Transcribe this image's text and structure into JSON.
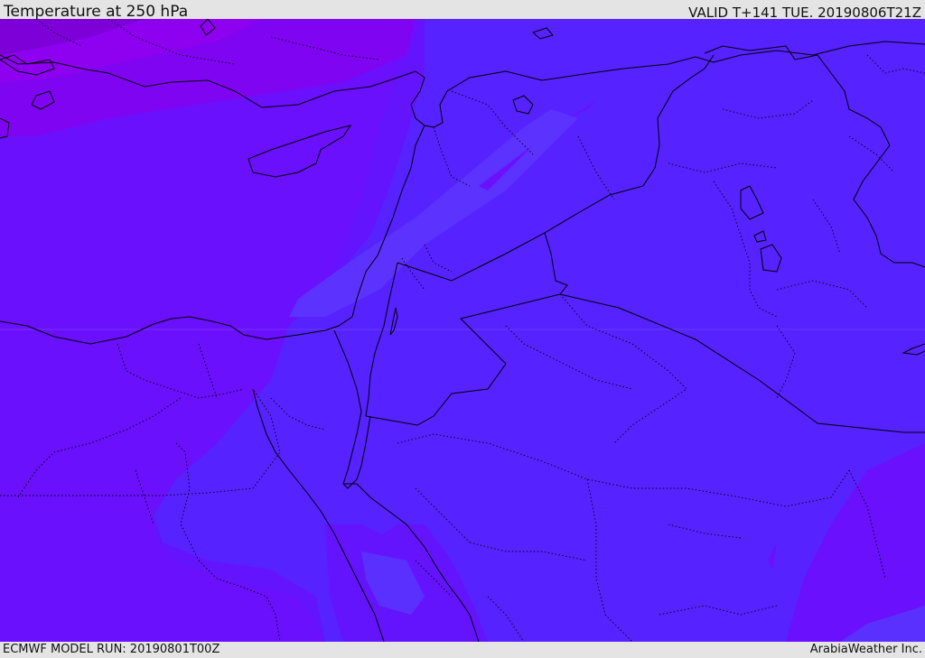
{
  "header": {
    "title": "Temperature at 250 hPa",
    "valid": "VALID T+141 TUE. 20190806T21Z"
  },
  "footer": {
    "model_run": "ECMWF MODEL RUN: 20190801T00Z",
    "credit": "ArabiaWeather Inc."
  },
  "colors": {
    "deep_violet": "#7a00e8",
    "violet": "#8a00f6",
    "purple": "#6f0dfb",
    "indigo": "#6414fd",
    "blue_violet": "#5522ff",
    "light_band": "#5a30ff",
    "coastline": "#000000"
  }
}
